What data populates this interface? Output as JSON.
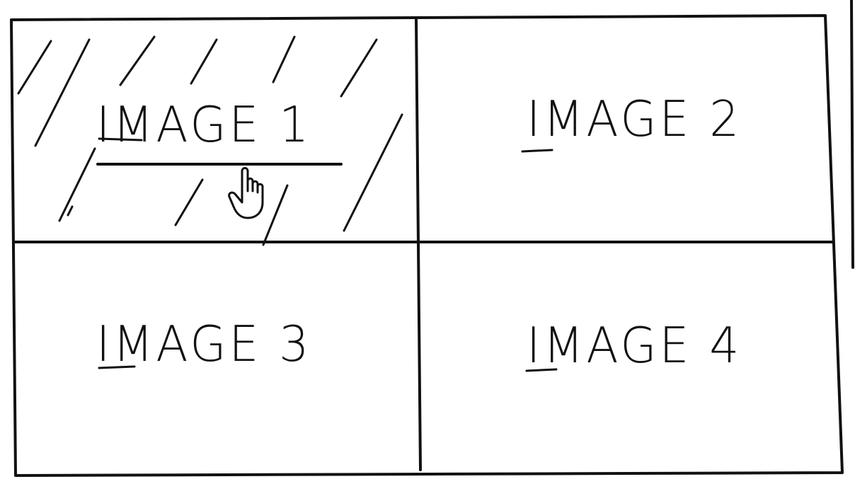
{
  "gallery": {
    "tiles": [
      {
        "label": "IMAGE 1",
        "state": "hovered"
      },
      {
        "label": "IMAGE 2",
        "state": "default"
      },
      {
        "label": "IMAGE 3",
        "state": "default"
      },
      {
        "label": "IMAGE 4",
        "state": "default"
      }
    ],
    "cursor": {
      "icon": "hand-pointer-icon",
      "over_tile": "IMAGE 1"
    }
  },
  "colors": {
    "ink": "#111111",
    "background": "#ffffff"
  }
}
